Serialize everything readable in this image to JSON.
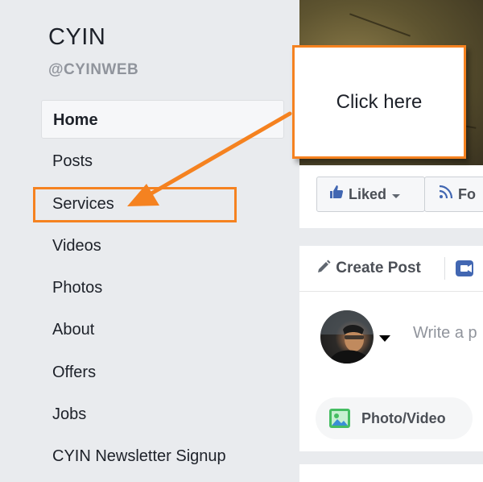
{
  "page": {
    "name": "CYIN",
    "handle": "@CYINWEB"
  },
  "nav": {
    "items": [
      {
        "label": "Home",
        "active": true
      },
      {
        "label": "Posts"
      },
      {
        "label": "Services",
        "highlighted": true
      },
      {
        "label": "Videos"
      },
      {
        "label": "Photos"
      },
      {
        "label": "About"
      },
      {
        "label": "Offers"
      },
      {
        "label": "Jobs"
      },
      {
        "label": "CYIN Newsletter Signup"
      }
    ]
  },
  "actions": {
    "liked_label": "Liked",
    "follow_label": "Fo"
  },
  "composer": {
    "create_post_label": "Create Post",
    "placeholder": "Write a p",
    "photo_video_label": "Photo/Video"
  },
  "annotation": {
    "callout_text": "Click here"
  },
  "colors": {
    "accent_orange": "#f58220",
    "background": "#e9ebee",
    "facebook_blue": "#4267b2"
  },
  "icons": {
    "liked": "thumbs-up-icon",
    "follow": "rss-icon",
    "create_post": "pencil-icon",
    "live": "video-camera-icon",
    "photo": "photo-icon"
  }
}
